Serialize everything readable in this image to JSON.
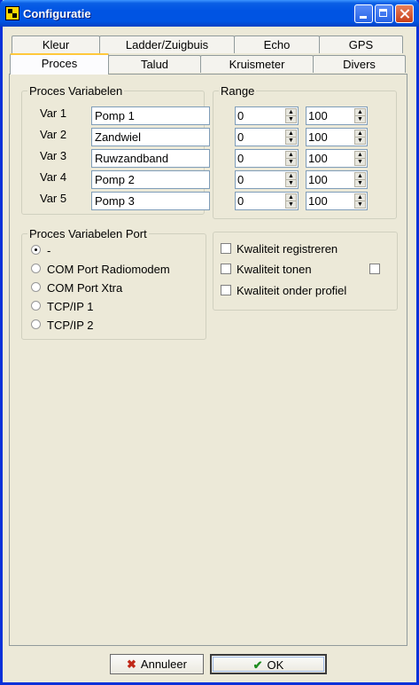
{
  "window": {
    "title": "Configuratie"
  },
  "tabs": {
    "row_back": [
      {
        "label": "Kleur"
      },
      {
        "label": "Ladder/Zuigbuis"
      },
      {
        "label": "Echo"
      },
      {
        "label": "GPS"
      }
    ],
    "row_front": [
      {
        "label": "Proces",
        "active": true
      },
      {
        "label": "Talud"
      },
      {
        "label": "Kruismeter"
      },
      {
        "label": "Divers"
      }
    ]
  },
  "proces_variabelen": {
    "title": "Proces Variabelen",
    "rows": [
      {
        "label": "Var 1",
        "value": "Pomp 1"
      },
      {
        "label": "Var 2",
        "value": "Zandwiel"
      },
      {
        "label": "Var 3",
        "value": "Ruwzandband"
      },
      {
        "label": "Var 4",
        "value": "Pomp 2"
      },
      {
        "label": "Var 5",
        "value": "Pomp 3"
      }
    ]
  },
  "range": {
    "title": "Range",
    "rows": [
      {
        "min": "0",
        "max": "100"
      },
      {
        "min": "0",
        "max": "100"
      },
      {
        "min": "0",
        "max": "100"
      },
      {
        "min": "0",
        "max": "100"
      },
      {
        "min": "0",
        "max": "100"
      }
    ]
  },
  "port": {
    "title": "Proces Variabelen Port",
    "options": [
      {
        "label": "-",
        "selected": true
      },
      {
        "label": "COM Port Radiomodem",
        "selected": false
      },
      {
        "label": "COM Port Xtra",
        "selected": false
      },
      {
        "label": "TCP/IP 1",
        "selected": false
      },
      {
        "label": "TCP/IP 2",
        "selected": false
      }
    ]
  },
  "kwaliteit": {
    "items": [
      {
        "label": "Kwaliteit registreren",
        "checked": false
      },
      {
        "label": "Kwaliteit tonen",
        "checked": false
      },
      {
        "label": "Kwaliteit onder profiel",
        "checked": false
      }
    ]
  },
  "buttons": {
    "cancel": "Annuleer",
    "ok": "OK"
  },
  "icons": {
    "cancel": "x-icon",
    "ok": "checkmark-icon"
  },
  "colors": {
    "titlebar": "#0054e3",
    "cancel_icon": "#c0291a",
    "ok_icon": "#1e8c1e"
  }
}
